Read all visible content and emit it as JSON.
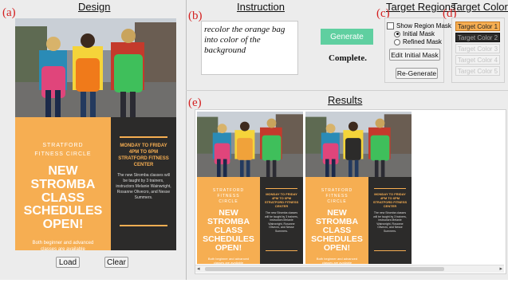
{
  "sections": {
    "design": "Design",
    "instruction": "Instruction",
    "target_regions": "Target Regions",
    "target_colors": "Target Colors",
    "results": "Results"
  },
  "panel_labels": {
    "a": "(a)",
    "b": "(b)",
    "c": "(c)",
    "d": "(d)",
    "e": "(e)"
  },
  "instruction": {
    "text": "recolor the orange bag into color of the background",
    "generate_label": "Generate",
    "status": "Complete."
  },
  "regions": {
    "show_mask_label": "Show Region Mask",
    "initial_mask_label": "Initial Mask",
    "refined_mask_label": "Refined Mask",
    "edit_label": "Edit Initial Mask",
    "regenerate_label": "Re-Generate"
  },
  "colors": {
    "items": [
      "Target Color 1",
      "Target Color 2",
      "Target Color 3",
      "Target Color 4",
      "Target Color 5"
    ],
    "values": [
      "#f6ae52",
      "#2c2b2a"
    ]
  },
  "design": {
    "load_label": "Load",
    "clear_label": "Clear"
  },
  "poster": {
    "subtitle": "STRATFORD FITNESS CIRCLE",
    "headline": "NEW STROMBA CLASS SCHEDULES OPEN!",
    "footer": "Both beginner and advanced classes are available",
    "days": "MONDAY TO FRIDAY 4PM TO 6PM STRATFORD FITNESS CENTER",
    "body": "The new Stromba classes will be taught by 3 trainers, instructors Melanie Wainwright, Rosanne Olivecro, and Nesse Summers."
  },
  "theme": {
    "orange": "#f6ae52",
    "dark": "#2c2b2a",
    "generate_green": "#5fcfa0",
    "label_red": "#d42020"
  }
}
